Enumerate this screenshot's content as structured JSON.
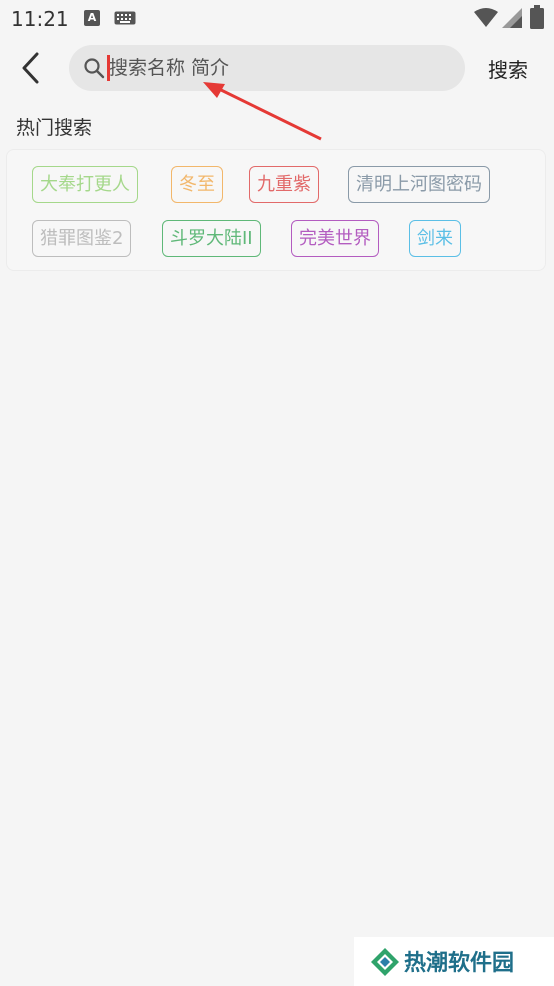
{
  "status_bar": {
    "time": "11:21",
    "notification_icons": [
      "a-icon",
      "keyboard-icon"
    ],
    "system_icons": [
      "wifi-icon",
      "signal-icon",
      "battery-icon"
    ]
  },
  "header": {
    "back_icon": "chevron-left-icon",
    "search": {
      "placeholder": "搜索名称 简介",
      "value": ""
    },
    "search_button_label": "搜索"
  },
  "hot_search": {
    "title": "热门搜索",
    "tags": [
      {
        "label": "大奉打更人",
        "color": "#a5d88b"
      },
      {
        "label": "冬至",
        "color": "#f2b76b"
      },
      {
        "label": "九重紫",
        "color": "#e26a6a"
      },
      {
        "label": "清明上河图密码",
        "color": "#8a9aa8"
      },
      {
        "label": "猎罪图鉴2",
        "color": "#bdbdbd"
      },
      {
        "label": "斗罗大陆II",
        "color": "#5fb878"
      },
      {
        "label": "完美世界",
        "color": "#b35cc0"
      },
      {
        "label": "剑来",
        "color": "#5bbfe6"
      }
    ]
  },
  "watermark": {
    "text": "热潮软件园"
  },
  "colors": {
    "background": "#f5f5f5",
    "search_box": "#e6e6e6",
    "annotation_arrow": "#e53935"
  }
}
